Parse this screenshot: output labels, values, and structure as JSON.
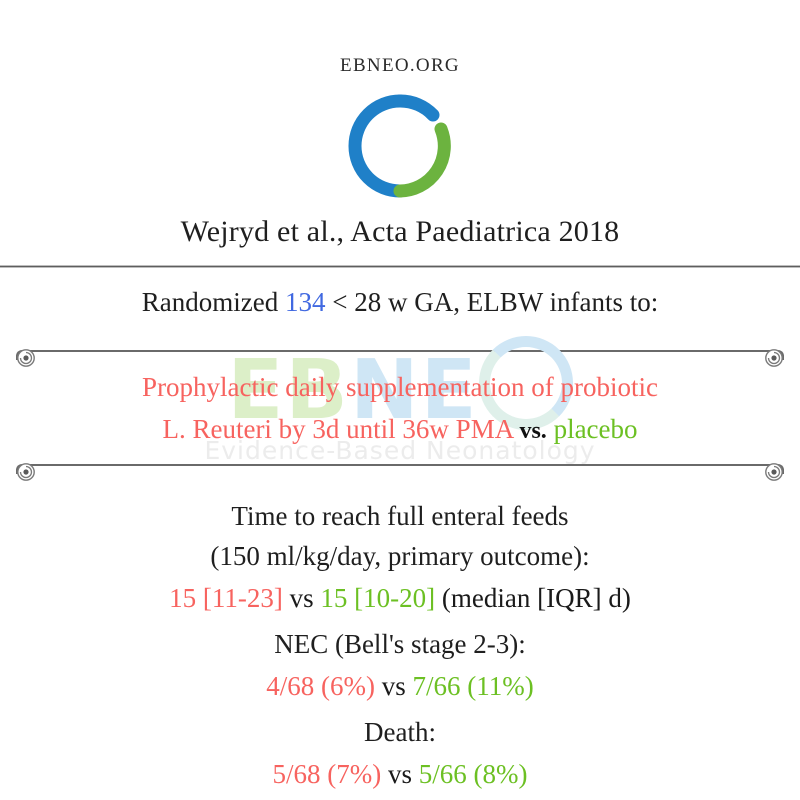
{
  "header": {
    "brand_url": "EBNEO.ORG",
    "logo_icon": "ebneo-circle-logo",
    "logo_blue": "#1f80c8",
    "logo_green": "#6cb33f"
  },
  "citation": "Wejryd et al., Acta Paediatrica 2018",
  "population": {
    "prefix": "Randomized",
    "count": "134",
    "count_color": "#4169e1",
    "suffix": "< 28 w GA, ELBW infants to:"
  },
  "intervention": {
    "line1": "Prophylactic daily supplementation of probiotic",
    "line2_intervention": "L. Reuteri by 3d until 36w PMA",
    "vs": "vs.",
    "line2_control": "placebo",
    "intervention_color": "#f7635f",
    "control_color": "#6cc023",
    "rivet_icon": "screw-rivet-icon"
  },
  "watermark": {
    "word_e": "E",
    "word_b": "B",
    "word_n": "N",
    "word_e2": "E",
    "word_o_icon": "ebneo-o-ring-icon",
    "tagline": "Evidence-Based Neonatology"
  },
  "outcomes": [
    {
      "label_line1": "Time to reach full enteral feeds",
      "label_line2": "(150 ml/kg/day, primary outcome):",
      "intervention_value": "15 [11-23]",
      "vs": "vs",
      "control_value": "15 [10-20]",
      "note": "(median [IQR] d)"
    },
    {
      "label_line1": "NEC (Bell's stage 2-3):",
      "label_line2": "",
      "intervention_value": "4/68 (6%)",
      "vs": "vs",
      "control_value": "7/66 (11%)",
      "note": ""
    },
    {
      "label_line1": "Death:",
      "label_line2": "",
      "intervention_value": "5/68 (7%)",
      "vs": "vs",
      "control_value": "5/66 (8%)",
      "note": ""
    }
  ]
}
